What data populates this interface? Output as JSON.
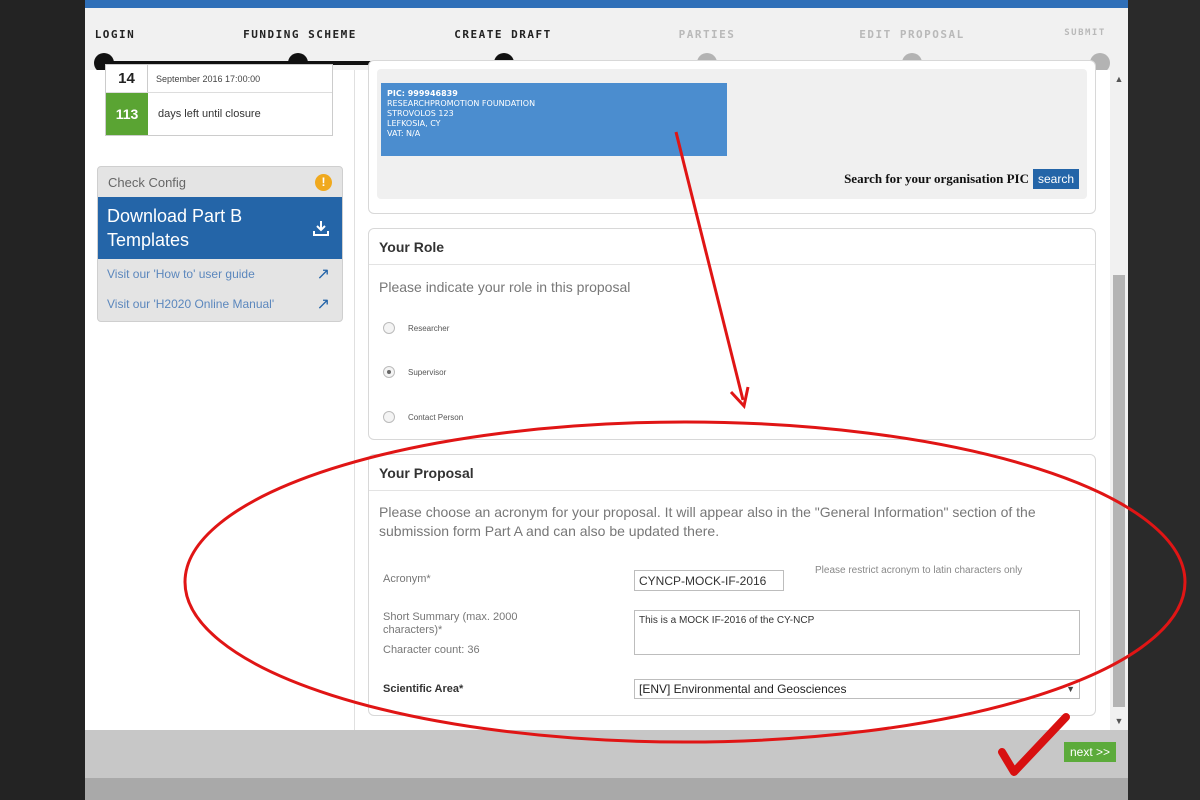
{
  "stepper": {
    "steps": [
      {
        "label": "LOGIN",
        "state": "done"
      },
      {
        "label": "FUNDING SCHEME",
        "state": "done"
      },
      {
        "label": "CREATE DRAFT",
        "state": "current"
      },
      {
        "label": "PARTIES",
        "state": "future"
      },
      {
        "label": "EDIT PROPOSAL",
        "state": "future"
      },
      {
        "label": "SUBMIT",
        "state": "future"
      }
    ]
  },
  "deadline": {
    "day": "14",
    "datetime": "September 2016 17:00:00",
    "days_left": "113",
    "days_left_text": "days left until closure"
  },
  "tools": {
    "check_config": "Check Config",
    "download_templates": "Download Part B Templates",
    "howto_link": "Visit our 'How to' user guide",
    "manual_link": "Visit our 'H2020 Online Manual'"
  },
  "organisation": {
    "pic": "PIC: 999946839",
    "name": "RESEARCHPROMOTION FOUNDATION",
    "street": "STROVOLOS 123",
    "city": "LEFKOSIA, CY",
    "vat": "VAT: N/A",
    "search_prompt": "Search for your organisation PIC",
    "search_button": "search"
  },
  "role": {
    "title": "Your Role",
    "prompt": "Please indicate your role in this proposal",
    "options": [
      {
        "label": "Researcher",
        "selected": false
      },
      {
        "label": "Supervisor",
        "selected": true
      },
      {
        "label": "Contact Person",
        "selected": false
      }
    ]
  },
  "proposal": {
    "title": "Your Proposal",
    "description": "Please choose an acronym for your proposal. It will appear also in the \"General Information\" section of the submission form Part A and can also be updated there.",
    "acronym_label": "Acronym*",
    "acronym_value": "CYNCP-MOCK-IF-2016",
    "acronym_hint": "Please restrict acronym to latin characters only",
    "summary_label": "Short Summary (max. 2000 characters)*",
    "char_count": "Character count: 36",
    "summary_value": "This is a MOCK IF-2016 of the CY-NCP",
    "area_label": "Scientific Area*",
    "area_value": "[ENV] Environmental and Geosciences"
  },
  "actions": {
    "next": "next >>"
  },
  "colors": {
    "accent": "#2465a8",
    "success": "#5aa433",
    "annotation": "#e01515"
  }
}
